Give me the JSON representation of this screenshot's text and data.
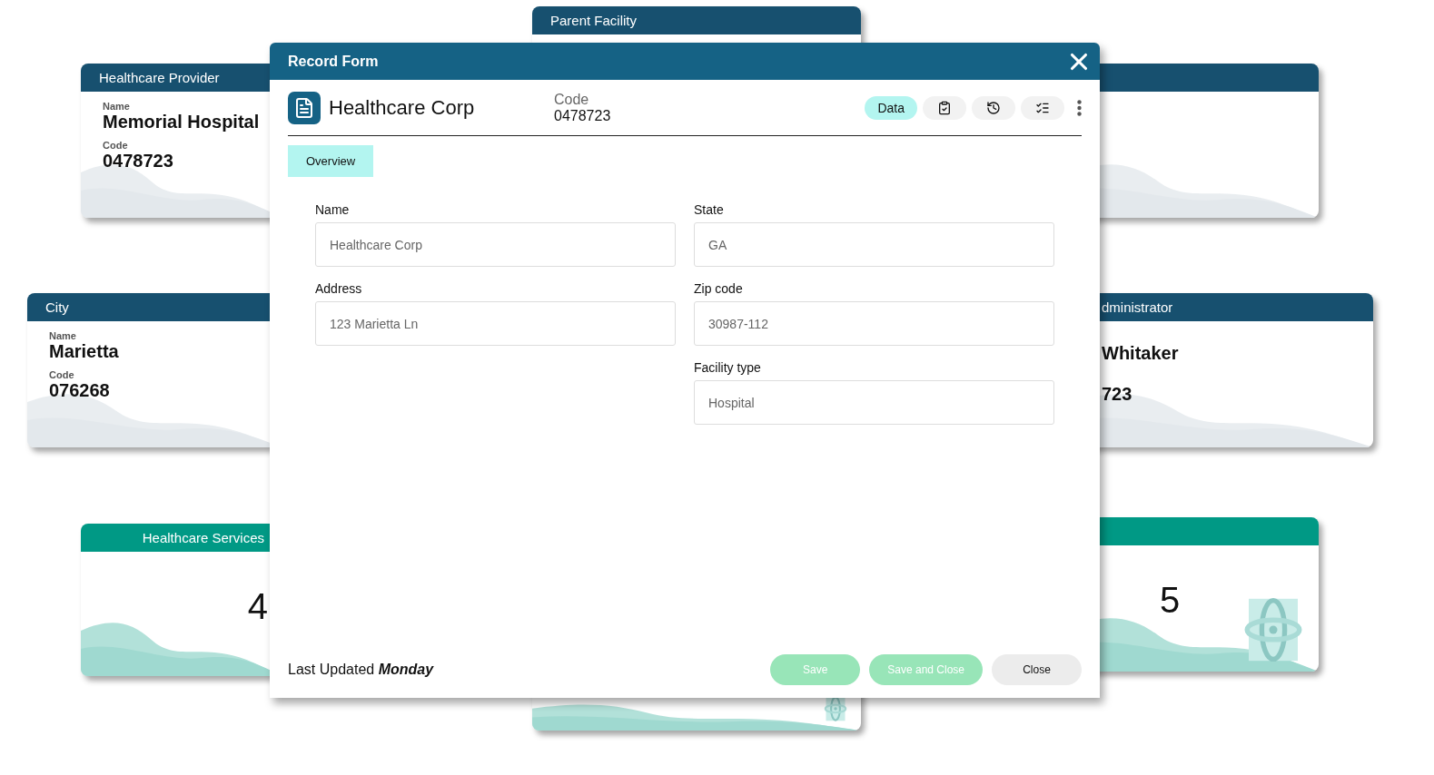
{
  "background_cards": [
    {
      "kind": "count",
      "title": "Parent Facility",
      "color": "#17506f"
    },
    {
      "kind": "info",
      "title": "Healthcare Provider",
      "color": "#17506f",
      "fields": [
        {
          "label": "Name",
          "value": "Memorial Hospital"
        },
        {
          "label": "Code",
          "value": "0478723"
        }
      ]
    },
    {
      "kind": "info",
      "color": "#17506f"
    },
    {
      "kind": "info",
      "title": "City",
      "color": "#17506f",
      "fields": [
        {
          "label": "Name",
          "value": "Marietta"
        },
        {
          "label": "Code",
          "value": "076268"
        }
      ]
    },
    {
      "kind": "info",
      "title": "dministrator",
      "color": "#17506f",
      "fields": [
        {
          "value": "Whitaker"
        },
        {
          "value": "723"
        }
      ]
    },
    {
      "kind": "count",
      "title": "Healthcare Services",
      "color": "#009985",
      "value": "4"
    },
    {
      "kind": "count",
      "color": "#009985",
      "value": "5"
    }
  ],
  "dialog": {
    "title": "Record Form",
    "record": {
      "name": "Healthcare Corp",
      "code_label": "Code",
      "code": "0478723"
    },
    "toolbar": [
      {
        "kind": "text",
        "label": "Data",
        "selected": true
      },
      {
        "kind": "clipboard",
        "selected": false
      },
      {
        "kind": "history",
        "selected": false
      },
      {
        "kind": "checklist",
        "selected": false
      }
    ],
    "tabs": [
      {
        "label": "Overview",
        "selected": true
      }
    ],
    "columns": [
      [
        {
          "label": "Name",
          "placeholder": "Healthcare Corp"
        },
        {
          "label": "Address",
          "placeholder": "123 Marietta Ln"
        }
      ],
      [
        {
          "label": "State",
          "placeholder": "GA"
        },
        {
          "label": "Zip code",
          "placeholder": "30987-112"
        },
        {
          "label": "Facility type",
          "placeholder": "Hospital"
        }
      ]
    ],
    "last_updated": "Last Updated **Monday**",
    "buttons": [
      {
        "label": "Save",
        "kind": "primary"
      },
      {
        "label": "Save and Close",
        "kind": "primary"
      },
      {
        "label": "Close",
        "kind": "secondary"
      }
    ]
  }
}
